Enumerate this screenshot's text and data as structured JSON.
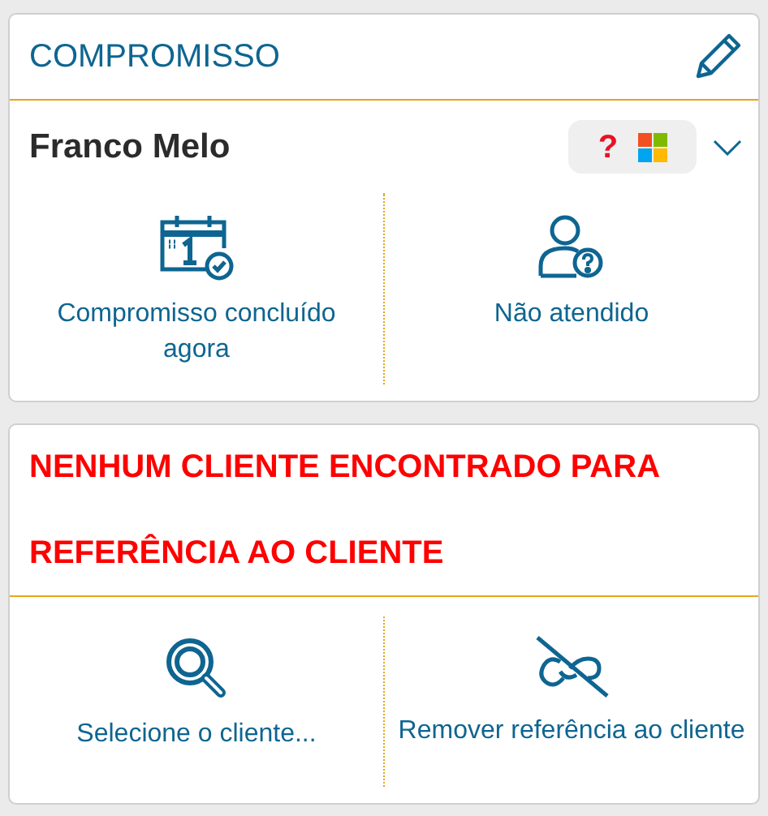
{
  "appointment_card": {
    "title": "COMPROMISSO",
    "contact_name": "Franco Melo",
    "status_badge": "?",
    "actions": [
      {
        "kind": "completed",
        "label": "Compromisso concluído agora"
      },
      {
        "kind": "no_show",
        "label": "Não atendido"
      }
    ]
  },
  "customer_card": {
    "title_lines": [
      "NENHUM CLIENTE ENCONTRADO PARA",
      "REFERÊNCIA AO CLIENTE"
    ],
    "actions": [
      {
        "kind": "select",
        "label": "Selecione o cliente..."
      },
      {
        "kind": "unlink",
        "label": "Remover referência ao cliente"
      }
    ]
  }
}
